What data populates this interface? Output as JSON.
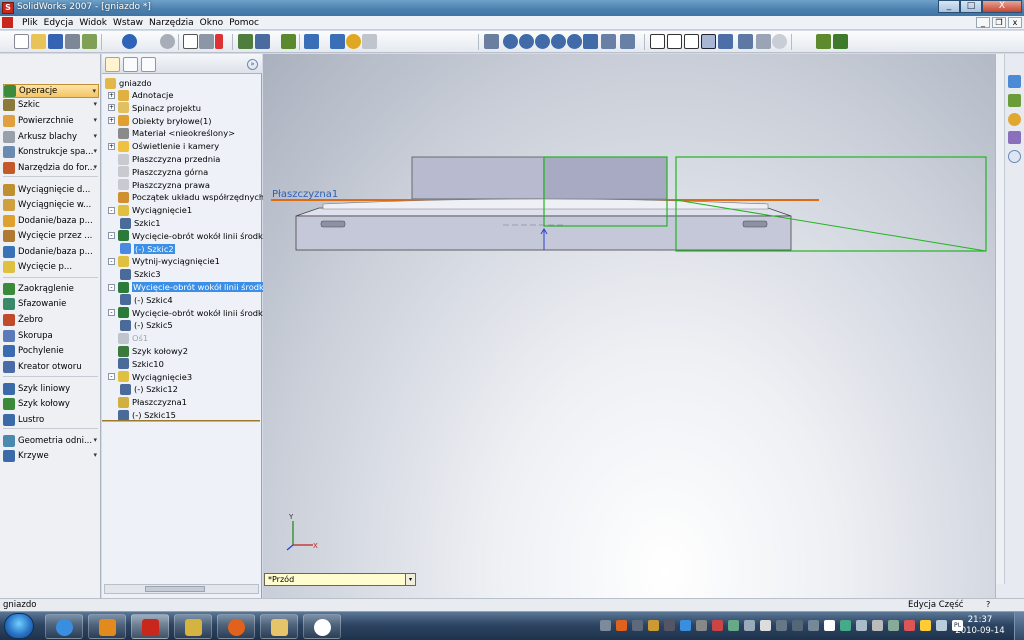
{
  "window": {
    "title": "SolidWorks 2007 - [gniazdo *]",
    "app_icon_letter": "S",
    "btn_min": "_",
    "btn_max": "□",
    "btn_close": "X"
  },
  "menu": [
    "Plik",
    "Edycja",
    "Widok",
    "Wstaw",
    "Narzędzia",
    "Okno",
    "Pomoc"
  ],
  "mdi_buttons": {
    "minimize": "_",
    "restore": "❐",
    "close": "x"
  },
  "command_manager": [
    {
      "label": "Operacje",
      "dropdown": true,
      "active": true
    },
    {
      "label": "Szkic",
      "dropdown": true
    },
    {
      "label": "Powierzchnie",
      "dropdown": true
    },
    {
      "label": "Arkusz blachy",
      "dropdown": true
    },
    {
      "label": "Konstrukcje spa...",
      "dropdown": true
    },
    {
      "label": "Narzędzia do for...",
      "dropdown": true
    },
    {
      "label": "Wyciągnięcie d..."
    },
    {
      "label": "Wyciągnięcie w..."
    },
    {
      "label": "Dodanie/baza p..."
    },
    {
      "label": "Wycięcie przez ..."
    },
    {
      "label": "Dodanie/baza p..."
    },
    {
      "label": "Wycięcie p..."
    },
    {
      "label": "Zaokrąglenie"
    },
    {
      "label": "Sfazowanie"
    },
    {
      "label": "Żebro"
    },
    {
      "label": "Skorupa"
    },
    {
      "label": "Pochylenie"
    },
    {
      "label": "Kreator otworu"
    },
    {
      "label": "Szyk liniowy"
    },
    {
      "label": "Szyk kołowy"
    },
    {
      "label": "Lustro"
    },
    {
      "label": "Geometria odni...",
      "dropdown": true
    },
    {
      "label": "Krzywe",
      "dropdown": true
    }
  ],
  "feature_tree": {
    "expand_glyph": "»",
    "root": "gniazdo",
    "nodes": [
      {
        "label": "Adnotacje",
        "expander": "+"
      },
      {
        "label": "Spinacz projektu",
        "expander": "+"
      },
      {
        "label": "Obiekty bryłowe(1)",
        "expander": "+"
      },
      {
        "label": "Materiał <nieokreślony>",
        "expander": ""
      },
      {
        "label": "Oświetlenie i kamery",
        "expander": "+"
      },
      {
        "label": "Płaszczyzna przednia",
        "expander": ""
      },
      {
        "label": "Płaszczyzna górna",
        "expander": ""
      },
      {
        "label": "Płaszczyzna prawa",
        "expander": ""
      },
      {
        "label": "Początek układu współrzędnych",
        "expander": ""
      },
      {
        "label": "Wyciągnięcie1",
        "expander": "-"
      },
      {
        "label": "Szkic1",
        "expander": ""
      },
      {
        "label": "Wycięcie-obrót wokół linii środkowej1",
        "expander": "-"
      },
      {
        "label": "(-) Szkic2",
        "expander": "",
        "selected": true
      },
      {
        "label": "Wytnij-wyciągnięcie1",
        "expander": "-"
      },
      {
        "label": "Szkic3",
        "expander": ""
      },
      {
        "label": "Wycięcie-obrót wokół linii środkowej2",
        "expander": "-",
        "selected": true
      },
      {
        "label": "(-) Szkic4",
        "expander": ""
      },
      {
        "label": "Wycięcie-obrót wokół linii środkowej3",
        "expander": "-"
      },
      {
        "label": "(-) Szkic5",
        "expander": ""
      },
      {
        "label": "Oś1",
        "expander": "",
        "grey": true
      },
      {
        "label": "Szyk kołowy2",
        "expander": ""
      },
      {
        "label": "Szkic10",
        "expander": ""
      },
      {
        "label": "Wyciągnięcie3",
        "expander": "-"
      },
      {
        "label": "(-) Szkic12",
        "expander": ""
      },
      {
        "label": "Płaszczyzna1",
        "expander": ""
      },
      {
        "label": "(-) Szkic15",
        "expander": ""
      }
    ]
  },
  "graphics": {
    "plane_label": "Płaszczyzna1",
    "triad_y": "Y",
    "triad_x": "X",
    "view_orientation": "*Przód",
    "view_dropdown": "▾"
  },
  "statusbar": {
    "left": "gniazdo",
    "right": "Edycja Część",
    "help": "?"
  },
  "taskbar": {
    "time": "21:37",
    "date": "2010-09-14",
    "tray_lang": "PL"
  },
  "colors": {
    "selection": "#3b8fe6",
    "plane": "#e06a10",
    "sketch_green": "#22b422",
    "part_fill": "#c5c8d8"
  }
}
